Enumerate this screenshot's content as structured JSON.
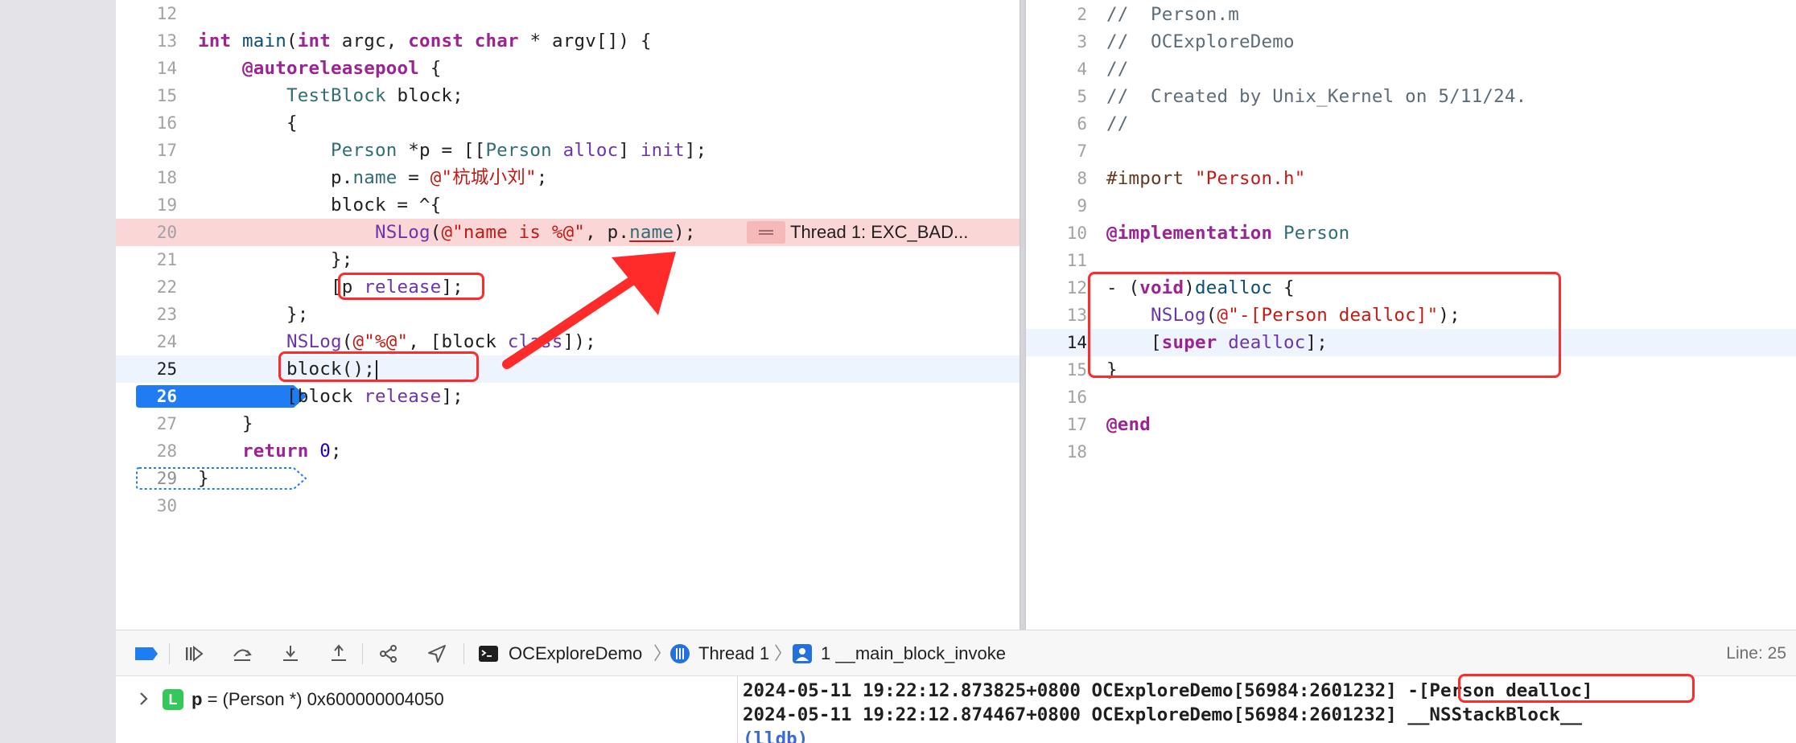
{
  "left_editor": {
    "lines": [
      {
        "n": "12",
        "html": ""
      },
      {
        "n": "13",
        "html": "<span class=\"kw\">int</span> <span class=\"ty\">main</span>(<span class=\"kw\">int</span> argc, <span class=\"kw\">const</span> <span class=\"kw\">char</span> * argv[]) {"
      },
      {
        "n": "14",
        "html": "    <span class=\"kw\">@autoreleasepool</span> {"
      },
      {
        "n": "15",
        "html": "        <span class=\"cls\">TestBlock</span> block;"
      },
      {
        "n": "16",
        "html": "        {"
      },
      {
        "n": "17",
        "html": "            <span class=\"cls\">Person</span> *p = [[<span class=\"cls\">Person</span> <span class=\"fn\">alloc</span>] <span class=\"fn\">init</span>];"
      },
      {
        "n": "18",
        "html": "            p.<span class=\"cls\">name</span> = <span class=\"str\">@\"杭城小刘\"</span>;"
      },
      {
        "n": "19",
        "html": "            block = ^{"
      },
      {
        "n": "20",
        "html": "                <span class=\"fn\">NSLog</span>(<span class=\"str\">@\"name is %@\"</span>, p.<span class=\"cls ul\">name</span>);",
        "error": true
      },
      {
        "n": "21",
        "html": "            };"
      },
      {
        "n": "22",
        "html": "            [p <span class=\"fn\">release</span>];"
      },
      {
        "n": "23",
        "html": "        };"
      },
      {
        "n": "24",
        "html": "        <span class=\"fn\">NSLog</span>(<span class=\"str\">@\"%@\"</span>, [block <span class=\"fn\">class</span>]);"
      },
      {
        "n": "25",
        "html": "        block();<span class=\"cursor\"></span>",
        "highlight": true,
        "current": true
      },
      {
        "n": "26",
        "html": "        [block <span class=\"fn\">release</span>];",
        "breakpoint": "solid"
      },
      {
        "n": "27",
        "html": "    }"
      },
      {
        "n": "28",
        "html": "    <span class=\"kw\">return</span> <span class=\"num\">0</span>;"
      },
      {
        "n": "29",
        "html": "}",
        "breakpoint": "dotted"
      },
      {
        "n": "30",
        "html": ""
      }
    ],
    "error_text": "Thread 1: EXC_BAD..."
  },
  "right_editor": {
    "lines": [
      {
        "n": "2",
        "html": "<span class=\"cm\">//  Person.m</span>"
      },
      {
        "n": "3",
        "html": "<span class=\"cm\">//  OCExploreDemo</span>"
      },
      {
        "n": "4",
        "html": "<span class=\"cm\">//</span>"
      },
      {
        "n": "5",
        "html": "<span class=\"cm\">//  Created by Unix_Kernel on 5/11/24.</span>"
      },
      {
        "n": "6",
        "html": "<span class=\"cm\">//</span>"
      },
      {
        "n": "7",
        "html": ""
      },
      {
        "n": "8",
        "html": "<span class=\"pp\">#import</span> <span class=\"str\">\"Person.h\"</span>"
      },
      {
        "n": "9",
        "html": ""
      },
      {
        "n": "10",
        "html": "<span class=\"kw\">@implementation</span> <span class=\"cls\">Person</span>"
      },
      {
        "n": "11",
        "html": ""
      },
      {
        "n": "12",
        "html": "- (<span class=\"kw\">void</span>)<span class=\"ty\">dealloc</span> {"
      },
      {
        "n": "13",
        "html": "    <span class=\"fn\">NSLog</span>(<span class=\"str\">@\"-[Person dealloc]\"</span>);"
      },
      {
        "n": "14",
        "html": "    [<span class=\"kw\">super</span> <span class=\"fn\">dealloc</span>];",
        "highlight": true,
        "current": true
      },
      {
        "n": "15",
        "html": "}"
      },
      {
        "n": "16",
        "html": ""
      },
      {
        "n": "17",
        "html": "<span class=\"kw\">@end</span>"
      },
      {
        "n": "18",
        "html": ""
      }
    ]
  },
  "breakpoint_label": "26",
  "breakpoint_dotted_label": "29",
  "toolbar": {
    "project": "OCExploreDemo",
    "thread": "Thread 1",
    "frame": "1 __main_block_invoke",
    "line_indicator": "Line: 25"
  },
  "variables": {
    "badge": "L",
    "name": "p",
    "value": "= (Person *) 0x600000004050"
  },
  "console": {
    "lines": [
      "2024-05-11 19:22:12.873825+0800 OCExploreDemo[56984:2601232] -[Person dealloc]",
      "2024-05-11 19:22:12.874467+0800 OCExploreDemo[56984:2601232] __NSStackBlock__"
    ],
    "prompt": "(lldb)"
  },
  "colors": {
    "annotation_red": "#ff2a2a",
    "breakpoint_blue": "#1f7cf2",
    "error_line_bg": "#fbd6d6",
    "current_line_bg": "#eef4fd"
  }
}
